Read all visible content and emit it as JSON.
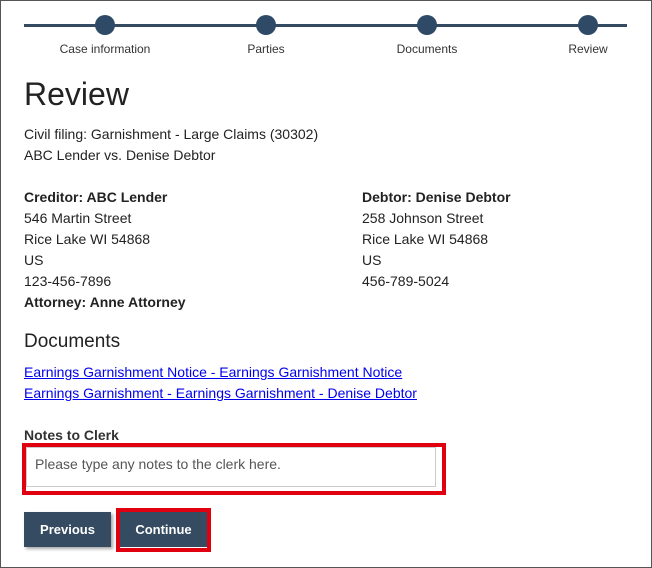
{
  "steps": [
    {
      "label": "Case information"
    },
    {
      "label": "Parties"
    },
    {
      "label": "Documents"
    },
    {
      "label": "Review"
    }
  ],
  "page_title": "Review",
  "filing_type": "Civil filing: Garnishment - Large Claims (30302)",
  "case_name": "ABC Lender vs. Denise Debtor",
  "creditor": {
    "heading": "Creditor: ABC Lender",
    "street": "546 Martin Street",
    "city": "Rice Lake WI 54868",
    "country": "US",
    "phone": "123-456-7896",
    "attorney": "Attorney: Anne Attorney"
  },
  "debtor": {
    "heading": "Debtor: Denise Debtor",
    "street": "258 Johnson Street",
    "city": "Rice Lake WI 54868",
    "country": "US",
    "phone": "456-789-5024"
  },
  "documents": {
    "heading": "Documents",
    "links": [
      "Earnings Garnishment Notice - Earnings Garnishment Notice",
      "Earnings Garnishment - Earnings Garnishment - Denise Debtor"
    ]
  },
  "notes": {
    "label": "Notes to Clerk",
    "placeholder": "Please type any notes to the clerk here.",
    "value": ""
  },
  "buttons": {
    "previous": "Previous",
    "continue": "Continue"
  },
  "colors": {
    "accent": "#344b61",
    "highlight": "#e00010",
    "link": "#0000ee"
  }
}
